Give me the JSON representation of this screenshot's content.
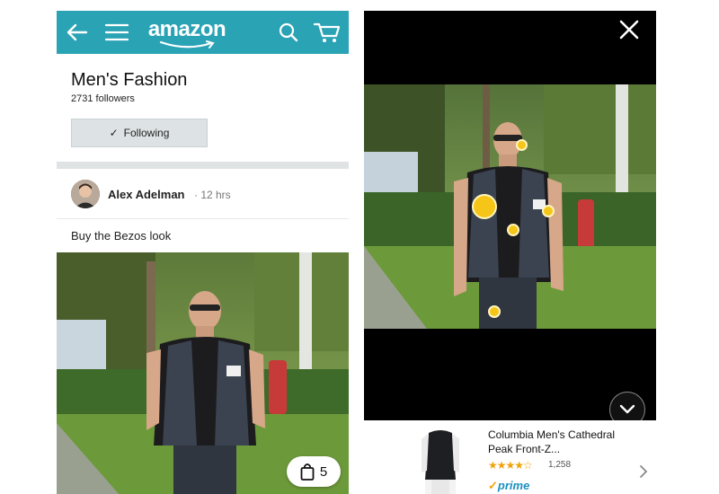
{
  "left_screen": {
    "header": {
      "logo_text": "amazon",
      "background": "#2aa3b5"
    },
    "page": {
      "title": "Men's Fashion",
      "followers": "2731 followers",
      "follow_button": "Following"
    },
    "post": {
      "author": "Alex Adelman",
      "time": "· 12 hrs",
      "caption": "Buy the Bezos look",
      "bag_count": "5"
    }
  },
  "right_screen": {
    "hotspot_color": "#f5c518",
    "product": {
      "title": "Columbia Men's Cathedral Peak Front-Z...",
      "stars": "★★★★☆",
      "reviews": "1,258",
      "prime": "prime"
    }
  },
  "icons": [
    "back-arrow-icon",
    "hamburger-menu-icon",
    "search-icon",
    "cart-icon",
    "checkmark-icon",
    "shopping-bag-icon",
    "close-icon",
    "chevron-down-icon",
    "chevron-right-icon"
  ]
}
